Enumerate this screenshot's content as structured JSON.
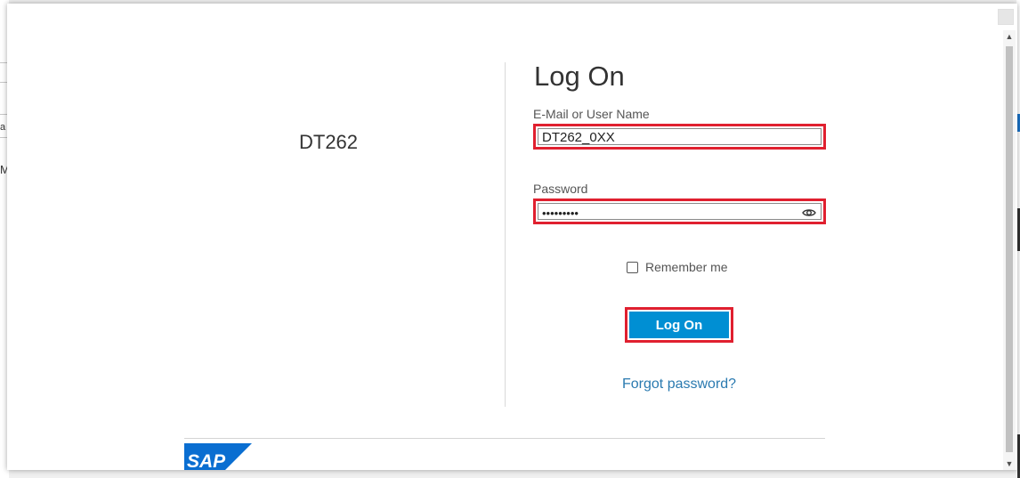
{
  "brand": {
    "title": "DT262",
    "logo_name": "SAP"
  },
  "form": {
    "title": "Log On",
    "username_label": "E-Mail or User Name",
    "username_value": "DT262_0XX",
    "password_label": "Password",
    "password_value": "•••••••••",
    "remember_label": "Remember me",
    "remember_checked": false,
    "submit_label": "Log On",
    "forgot_label": "Forgot password?"
  },
  "background": {
    "fragment_a": "a",
    "fragment_m": "M"
  },
  "colors": {
    "primary_button": "#008fd3",
    "highlight_border": "#e0202f",
    "link": "#2a7ab0",
    "sap_blue": "#0a6ed1"
  }
}
